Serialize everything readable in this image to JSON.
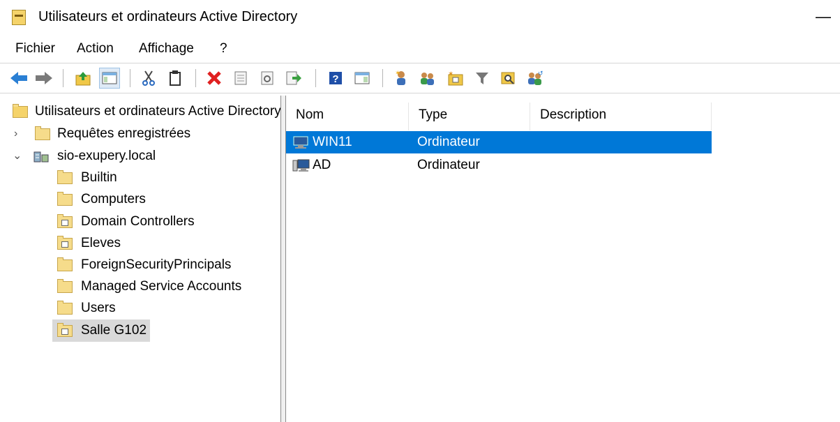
{
  "window": {
    "title": "Utilisateurs et ordinateurs Active Directory",
    "minimize_glyph": "—"
  },
  "menu": [
    "Fichier",
    "Action",
    "Affichage",
    "?"
  ],
  "toolbar": {
    "buttons": [
      "back-arrow-icon",
      "forward-arrow-icon",
      "up-folder-icon",
      "show-hide-console-tree-icon",
      "cut-icon",
      "copy-icon",
      "delete-icon",
      "properties-icon",
      "refresh-icon",
      "export-list-icon",
      "help-icon",
      "show-action-pane-icon",
      "new-user-icon",
      "new-group-icon",
      "new-ou-icon",
      "filter-icon",
      "find-icon",
      "add-to-group-icon"
    ]
  },
  "tree": {
    "root": "Utilisateurs et ordinateurs Active Directory",
    "saved_queries": "Requêtes enregistrées",
    "domain": "sio-exupery.local",
    "children": [
      {
        "label": "Builtin",
        "type": "container"
      },
      {
        "label": "Computers",
        "type": "container"
      },
      {
        "label": "Domain Controllers",
        "type": "ou"
      },
      {
        "label": "Eleves",
        "type": "ou"
      },
      {
        "label": "ForeignSecurityPrincipals",
        "type": "container"
      },
      {
        "label": "Managed Service Accounts",
        "type": "container"
      },
      {
        "label": "Users",
        "type": "container"
      },
      {
        "label": "Salle G102",
        "type": "ou",
        "selected": true
      }
    ]
  },
  "list": {
    "columns": [
      "Nom",
      "Type",
      "Description"
    ],
    "rows": [
      {
        "name": "WIN11",
        "type": "Ordinateur",
        "description": "",
        "selected": true
      },
      {
        "name": "AD",
        "type": "Ordinateur",
        "description": "",
        "selected": false
      }
    ]
  },
  "colors": {
    "selection": "#0078d7",
    "tree_selection": "#d9d9d9",
    "folder": "#f6dc8b"
  }
}
